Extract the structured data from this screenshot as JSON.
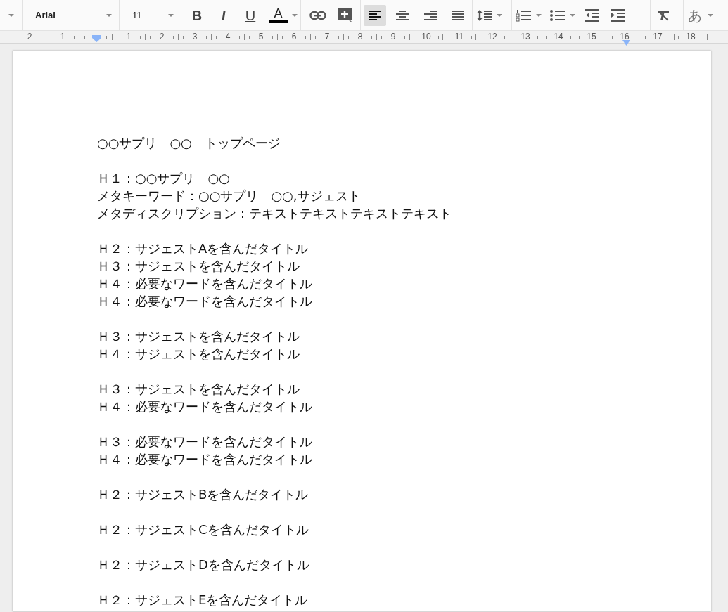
{
  "toolbar": {
    "font": "Arial",
    "size": "11",
    "bold": "B",
    "italic": "I",
    "underline": "U",
    "text_color": "A",
    "alignment": [
      {
        "selected": true
      },
      {
        "selected": false
      },
      {
        "selected": false
      },
      {
        "selected": false
      }
    ],
    "input_tool": "あ"
  },
  "ruler": {
    "left_labels": [
      "2",
      "1"
    ],
    "labels": [
      "1",
      "2",
      "3",
      "4",
      "5",
      "6",
      "7",
      "8",
      "9",
      "10",
      "11",
      "12",
      "13",
      "14",
      "15",
      "16",
      "17",
      "18"
    ]
  },
  "document": {
    "blocks": [
      [
        "○○サプリ　○○　トップページ"
      ],
      [
        "Ｈ１：○○サプリ　○○",
        "メタキーワード：○○サプリ　○○,サジェスト",
        "メタディスクリプション：テキストテキストテキストテキスト"
      ],
      [
        "Ｈ２：サジェストAを含んだタイトル",
        "Ｈ３：サジェストを含んだタイトル",
        "Ｈ４：必要なワードを含んだタイトル",
        "Ｈ４：必要なワードを含んだタイトル"
      ],
      [
        "Ｈ３：サジェストを含んだタイトル",
        "Ｈ４：サジェストを含んだタイトル"
      ],
      [
        "Ｈ３：サジェストを含んだタイトル",
        "Ｈ４：必要なワードを含んだタイトル"
      ],
      [
        "Ｈ３：必要なワードを含んだタイトル",
        "Ｈ４：必要なワードを含んだタイトル"
      ],
      [
        "Ｈ２：サジェストBを含んだタイトル"
      ],
      [
        "Ｈ２：サジェストCを含んだタイトル"
      ],
      [
        "Ｈ２：サジェストDを含んだタイトル"
      ],
      [
        "Ｈ２：サジェストEを含んだタイトル"
      ]
    ]
  }
}
